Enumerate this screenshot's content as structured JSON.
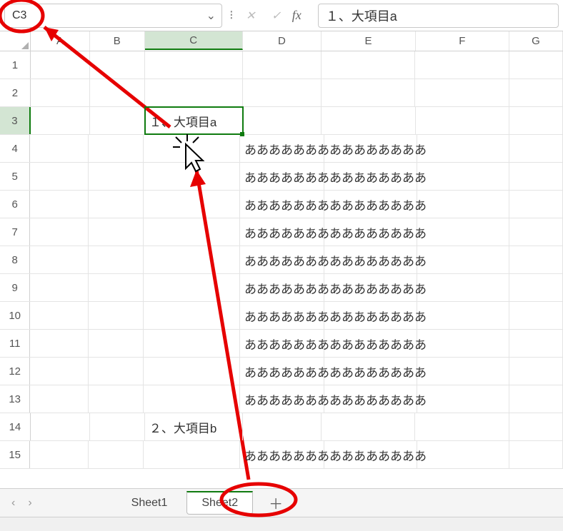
{
  "namebox": {
    "value": "C3"
  },
  "formula": {
    "value": "１、大項目a"
  },
  "columns": [
    "A",
    "B",
    "C",
    "D",
    "E",
    "F",
    "G"
  ],
  "selected": {
    "col": "C",
    "row": 3
  },
  "rows": [
    {
      "n": 1,
      "c": "",
      "d": ""
    },
    {
      "n": 2,
      "c": "",
      "d": ""
    },
    {
      "n": 3,
      "c": "１、大項目a",
      "d": ""
    },
    {
      "n": 4,
      "c": "",
      "d": "あああああああああああああああ"
    },
    {
      "n": 5,
      "c": "",
      "d": "あああああああああああああああ"
    },
    {
      "n": 6,
      "c": "",
      "d": "あああああああああああああああ"
    },
    {
      "n": 7,
      "c": "",
      "d": "あああああああああああああああ"
    },
    {
      "n": 8,
      "c": "",
      "d": "あああああああああああああああ"
    },
    {
      "n": 9,
      "c": "",
      "d": "あああああああああああああああ"
    },
    {
      "n": 10,
      "c": "",
      "d": "あああああああああああああああ"
    },
    {
      "n": 11,
      "c": "",
      "d": "あああああああああああああああ"
    },
    {
      "n": 12,
      "c": "",
      "d": "あああああああああああああああ"
    },
    {
      "n": 13,
      "c": "",
      "d": "あああああああああああああああ"
    },
    {
      "n": 14,
      "c": "２、大項目b",
      "d": ""
    },
    {
      "n": 15,
      "c": "",
      "d": "あああああああああああああああ"
    }
  ],
  "tabs": {
    "sheet1": "Sheet1",
    "sheet2": "Sheet2",
    "add": "＋"
  },
  "icons": {
    "chev": "⌄",
    "sep": "⁝",
    "cancel": "✕",
    "enter": "✓",
    "fx": "fx",
    "left": "‹",
    "right": "›"
  }
}
